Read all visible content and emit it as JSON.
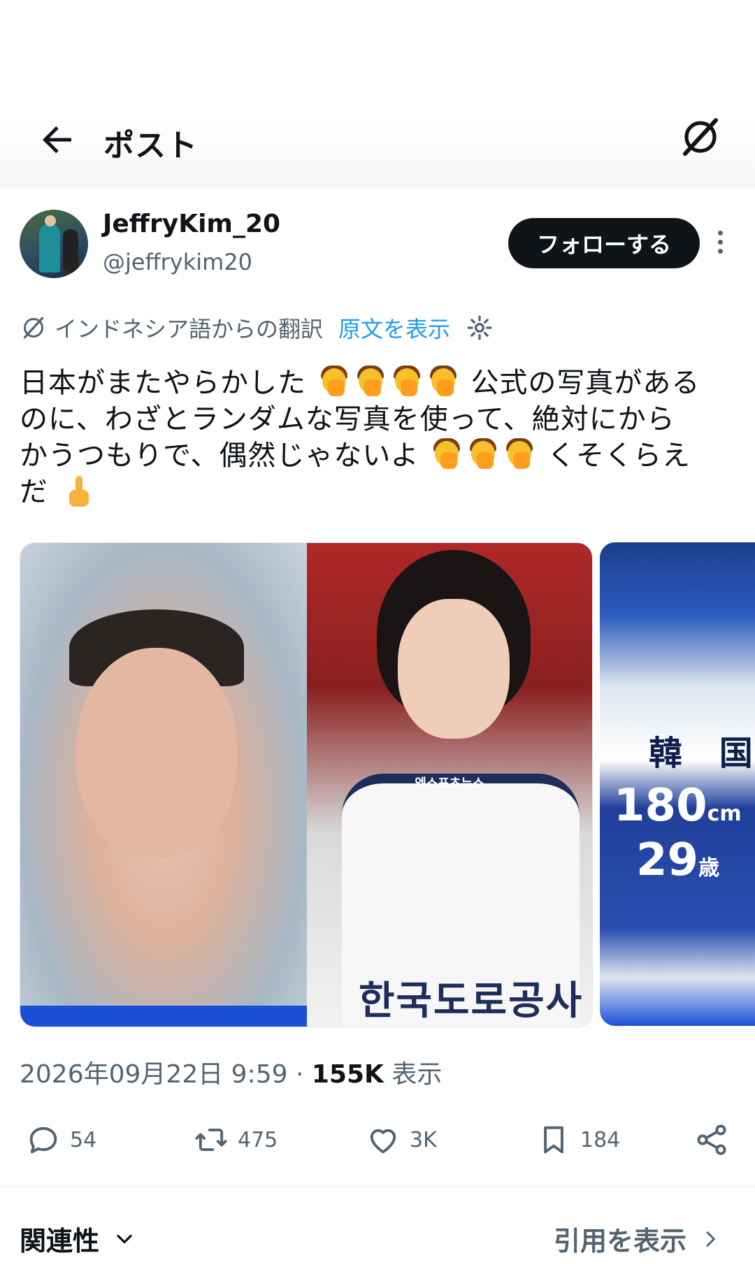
{
  "header": {
    "title": "ポスト",
    "back_icon": "arrow-left-icon",
    "grok_icon": "grok-icon"
  },
  "author": {
    "display_name": "JeffryKim_20",
    "handle": "@jeffrykim20",
    "follow_label": "フォローする"
  },
  "translation": {
    "label": "インドネシア語からの翻訳",
    "show_original": "原文を表示"
  },
  "post": {
    "line1": "日本がまたやらかした",
    "line1b": "公式の写真がある",
    "line2": "のに、わざとランダムな写真を使って、絶対にから",
    "line3": "かうつもりで、偶然じゃないよ",
    "line3b": "くそくらえ",
    "line4": "だ"
  },
  "media": {
    "watermark": "엑스포츠뉴스",
    "jersey_text": "한국도로공사",
    "caption_country": "韓 国",
    "caption_height": "180",
    "caption_height_unit": "cm",
    "caption_age": "29",
    "caption_age_unit": "歳"
  },
  "meta": {
    "date": "2026年09月22日 9:59",
    "separator": "·",
    "views": "155K",
    "views_label": "表示"
  },
  "actions": {
    "replies": "54",
    "reposts": "475",
    "likes": "3K",
    "bookmarks": "184"
  },
  "footer": {
    "relevance_label": "関連性",
    "quotes_label": "引用を表示"
  },
  "colors": {
    "accent": "#1d9bf0",
    "text": "#0f1419",
    "muted": "#536471"
  }
}
